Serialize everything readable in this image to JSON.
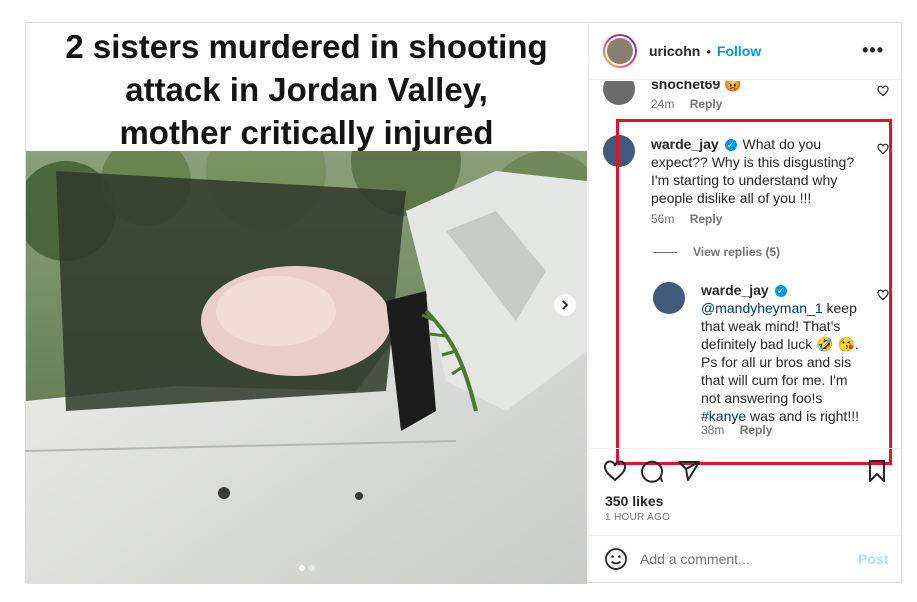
{
  "post": {
    "headline_lines": [
      "2 sisters murdered in shooting",
      "attack in Jordan Valley,",
      "mother critically injured"
    ],
    "carousel_position": 1,
    "carousel_count": 2
  },
  "header": {
    "username": "uricohn",
    "separator": "•",
    "follow_label": "Follow",
    "more_label": "•••"
  },
  "comments": [
    {
      "username": "shochet69",
      "text": "😡",
      "time": "24m",
      "reply_label": "Reply"
    },
    {
      "username": "warde_jay",
      "verified": true,
      "text": "What do you expect?? Why is this disgusting? I'm starting to understand why people dislike all of you !!!",
      "time": "56m",
      "reply_label": "Reply",
      "view_replies_label": "View replies (5)",
      "replies": [
        {
          "username": "warde_jay",
          "verified": true,
          "mention": "@mandyheyman_1",
          "text_part1": " keep that weak mind! That's definitely bad luck 🤣 😘. Ps for all ur bros and sis that will cum for me. I'm not answering foo!s ",
          "hashtag": "#kanye",
          "text_part2": " was and is right!!!",
          "time": "38m",
          "reply_label": "Reply"
        }
      ]
    }
  ],
  "actions": {
    "likes": "350 likes",
    "time_ago": "1 HOUR AGO"
  },
  "add_comment": {
    "placeholder": "Add a comment...",
    "post_label": "Post"
  },
  "colors": {
    "accent": "#0095f6",
    "highlight_box": "#e8112d",
    "post_disabled": "#b2dffc"
  }
}
